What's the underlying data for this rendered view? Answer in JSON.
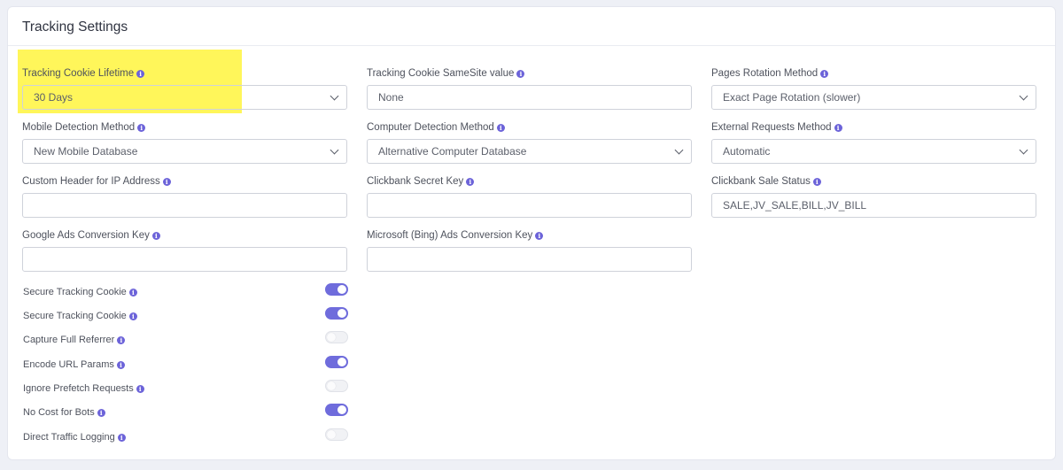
{
  "card": {
    "title": "Tracking Settings"
  },
  "fields": {
    "cookie_lifetime": {
      "label": "Tracking Cookie Lifetime",
      "value": "30 Days"
    },
    "samesite": {
      "label": "Tracking Cookie SameSite value",
      "value": "None"
    },
    "pages_rotation": {
      "label": "Pages Rotation Method",
      "value": "Exact Page Rotation (slower)"
    },
    "mobile_detection": {
      "label": "Mobile Detection Method",
      "value": "New Mobile Database"
    },
    "computer_detection": {
      "label": "Computer Detection Method",
      "value": "Alternative Computer Database"
    },
    "external_requests": {
      "label": "External Requests Method",
      "value": "Automatic"
    },
    "custom_header_ip": {
      "label": "Custom Header for IP Address",
      "value": ""
    },
    "clickbank_secret": {
      "label": "Clickbank Secret Key",
      "value": ""
    },
    "clickbank_sale_status": {
      "label": "Clickbank Sale Status",
      "value": "SALE,JV_SALE,BILL,JV_BILL"
    },
    "google_ads_key": {
      "label": "Google Ads Conversion Key",
      "value": ""
    },
    "bing_ads_key": {
      "label": "Microsoft (Bing) Ads Conversion Key",
      "value": ""
    }
  },
  "toggles": [
    {
      "label": "Secure Tracking Cookie",
      "on": true
    },
    {
      "label": "Secure Tracking Cookie",
      "on": true
    },
    {
      "label": "Capture Full Referrer",
      "on": false
    },
    {
      "label": "Encode URL Params",
      "on": true
    },
    {
      "label": "Ignore Prefetch Requests",
      "on": false
    },
    {
      "label": "No Cost for Bots",
      "on": true
    },
    {
      "label": "Direct Traffic Logging",
      "on": false
    }
  ],
  "colors": {
    "accent": "#6f6cdc",
    "highlight": "#fff65a"
  },
  "icons": {
    "info": "info-circle-icon",
    "select": "chevron-down-icon"
  }
}
